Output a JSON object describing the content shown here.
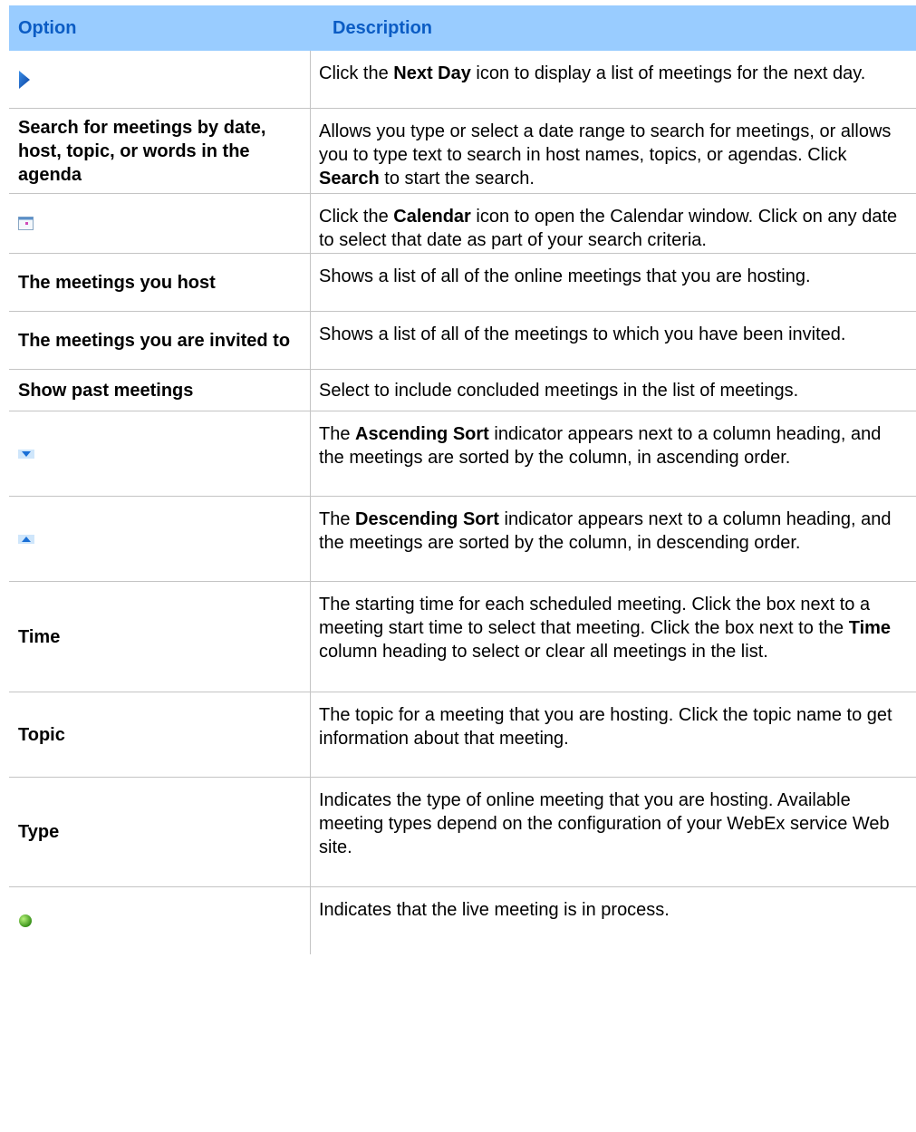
{
  "header": {
    "option": "Option",
    "description": "Description"
  },
  "colors": {
    "header_bg": "#99ccff",
    "header_text": "#0b5cc4",
    "divider": "#c4c4c4"
  },
  "rows": [
    {
      "option_icon": "next-day-arrow-icon",
      "option": "",
      "description": [
        "Click the ",
        {
          "b": "Next Day"
        },
        " icon to display a list of meetings for the next day."
      ]
    },
    {
      "option": "Search for meetings by date, host, topic, or words in the agenda",
      "description": [
        "Allows you type or select a date range to search for meetings, or allows you to type text to search in host names, topics, or agendas. Click ",
        {
          "b": "Search"
        },
        " to start the search."
      ]
    },
    {
      "option_icon": "calendar-icon",
      "option": "",
      "description": [
        "Click the ",
        {
          "b": "Calendar"
        },
        " icon to open the Calendar window. Click on any date to select that date as part of your search criteria."
      ]
    },
    {
      "option": "The meetings you host",
      "description": [
        "Shows a list of all of the online meetings that you are hosting."
      ]
    },
    {
      "option": "The meetings you are invited to",
      "description": [
        "Shows a list of all of the meetings to which you have been invited."
      ]
    },
    {
      "option": "Show past meetings",
      "description": [
        "Select to include concluded meetings in the list of meetings."
      ]
    },
    {
      "option_icon": "ascending-sort-icon",
      "option": "",
      "description": [
        "The ",
        {
          "b": "Ascending Sort"
        },
        " indicator appears next to a column heading, and the meetings are sorted by the column, in ascending order."
      ]
    },
    {
      "option_icon": "descending-sort-icon",
      "option": "",
      "description": [
        "The ",
        {
          "b": "Descending Sort"
        },
        " indicator appears next to a column heading, and the meetings are sorted by the column, in descending order."
      ]
    },
    {
      "option": "Time",
      "description": [
        "The starting time for each scheduled meeting. Click the box next to a meeting start time to select that meeting. Click the box next to the ",
        {
          "b": "Time"
        },
        " column heading to select or clear all meetings in the list."
      ]
    },
    {
      "option": "Topic",
      "description": [
        "The topic for a meeting that you are hosting. Click the topic name to get information about that meeting."
      ]
    },
    {
      "option": "Type",
      "description": [
        "Indicates the type of online meeting that you are hosting. Available meeting types depend on the configuration of your WebEx service Web site."
      ]
    },
    {
      "option_icon": "live-meeting-status-icon",
      "option": "",
      "description": [
        "Indicates that the live meeting is in process."
      ]
    }
  ]
}
